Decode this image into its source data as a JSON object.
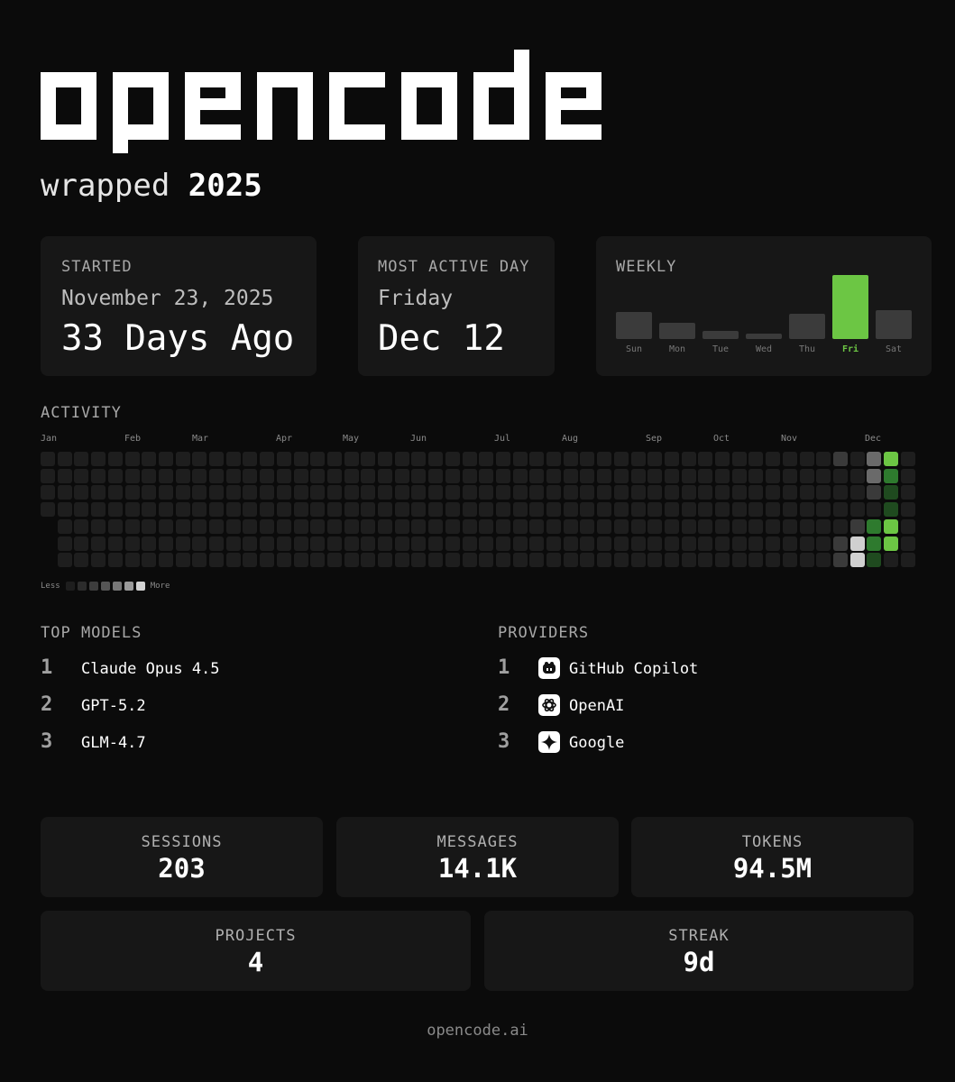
{
  "brand": {
    "logo_text": "opencode",
    "wrapped_label": "wrapped",
    "year": "2025"
  },
  "started": {
    "label": "STARTED",
    "date": "November 23, 2025",
    "ago": "33 Days Ago"
  },
  "most_active_day": {
    "label": "MOST ACTIVE DAY",
    "weekday": "Friday",
    "date": "Dec 12"
  },
  "weekly": {
    "label": "WEEKLY",
    "highlight_color": "#6cc644",
    "days": [
      {
        "name": "Sun",
        "value": 0.42,
        "active": false
      },
      {
        "name": "Mon",
        "value": 0.26,
        "active": false
      },
      {
        "name": "Tue",
        "value": 0.12,
        "active": false
      },
      {
        "name": "Wed",
        "value": 0.09,
        "active": false
      },
      {
        "name": "Thu",
        "value": 0.39,
        "active": false
      },
      {
        "name": "Fri",
        "value": 1.0,
        "active": true
      },
      {
        "name": "Sat",
        "value": 0.45,
        "active": false
      }
    ]
  },
  "activity": {
    "label": "ACTIVITY",
    "months": [
      "Jan",
      "Feb",
      "Mar",
      "Apr",
      "May",
      "Jun",
      "Jul",
      "Aug",
      "Sep",
      "Oct",
      "Nov",
      "Dec"
    ],
    "legend_less": "Less",
    "legend_more": "More",
    "legend_colors": [
      "#1e1e1e",
      "#2c2c2c",
      "#3d3d3d",
      "#555555",
      "#777777",
      "#9a9a9a",
      "#d2d2d2"
    ],
    "levels": {
      "empty": "#1e1e1e",
      "gray1": "#3a3a3a",
      "gray2": "#6a6a6a",
      "gray3": "#d0d0d0",
      "green1": "#1f4a1f",
      "green2": "#2e7a2e",
      "green3": "#6cc644"
    }
  },
  "top_models": {
    "label": "TOP MODELS",
    "items": [
      {
        "rank": "1",
        "name": "Claude Opus 4.5"
      },
      {
        "rank": "2",
        "name": "GPT-5.2"
      },
      {
        "rank": "3",
        "name": "GLM-4.7"
      }
    ]
  },
  "providers": {
    "label": "PROVIDERS",
    "items": [
      {
        "rank": "1",
        "name": "GitHub Copilot",
        "icon": "github-copilot-icon"
      },
      {
        "rank": "2",
        "name": "OpenAI",
        "icon": "openai-icon"
      },
      {
        "rank": "3",
        "name": "Google",
        "icon": "google-sparkle-icon"
      }
    ]
  },
  "stats": {
    "sessions": {
      "label": "SESSIONS",
      "value": "203"
    },
    "messages": {
      "label": "MESSAGES",
      "value": "14.1K"
    },
    "tokens": {
      "label": "TOKENS",
      "value": "94.5M"
    },
    "projects": {
      "label": "PROJECTS",
      "value": "4"
    },
    "streak": {
      "label": "STREAK",
      "value": "9d"
    }
  },
  "footer": {
    "url": "opencode.ai"
  }
}
